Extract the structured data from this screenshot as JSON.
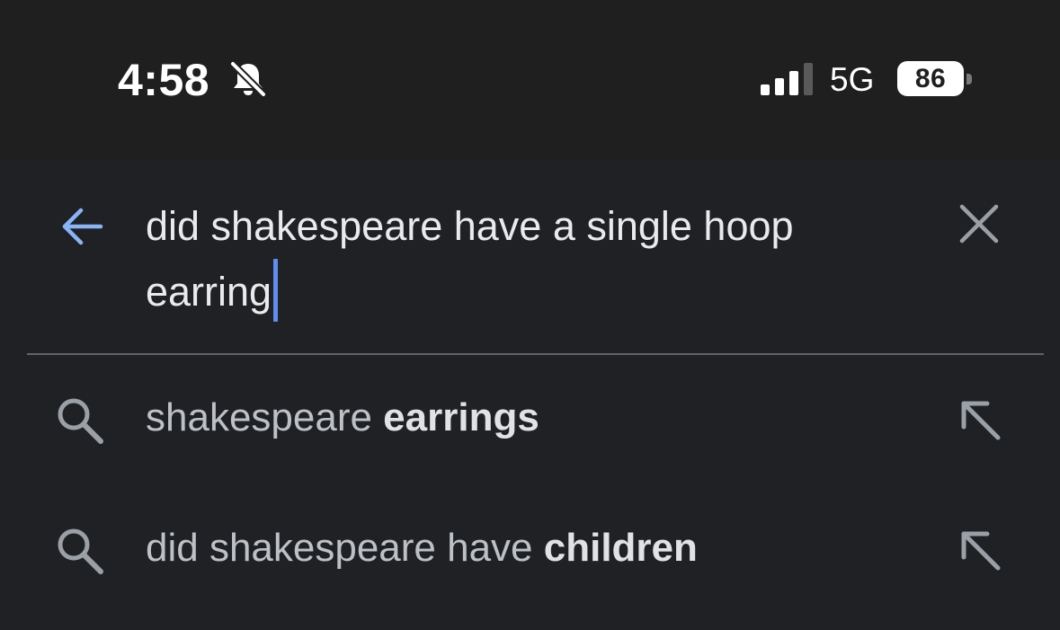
{
  "status_bar": {
    "time": "4:58",
    "network": "5G",
    "battery_level": "86",
    "silent_icon": "bell-slash-icon",
    "signal_icon": "cellular-signal-icon",
    "signal_bars_active": 3,
    "signal_bars_total": 4
  },
  "search": {
    "back_icon": "arrow-left-icon",
    "query_line1": "did shakespeare have a single hoop",
    "query_line2": "earring",
    "clear_icon": "close-icon"
  },
  "suggestions": [
    {
      "icon": "search-icon",
      "prefix": "shakespeare ",
      "bold": "earrings",
      "fill_icon": "arrow-up-left-icon"
    },
    {
      "icon": "search-icon",
      "prefix": "did shakespeare have ",
      "bold": "children",
      "fill_icon": "arrow-up-left-icon"
    }
  ],
  "colors": {
    "status_bar_bg": "#1f1f1f",
    "panel_bg": "#202124",
    "accent": "#8ab4f8",
    "caret": "#5f8ef0",
    "text_primary": "#e8eaed",
    "text_secondary": "#bdc1c6",
    "icon_gray": "#9aa0a6"
  }
}
